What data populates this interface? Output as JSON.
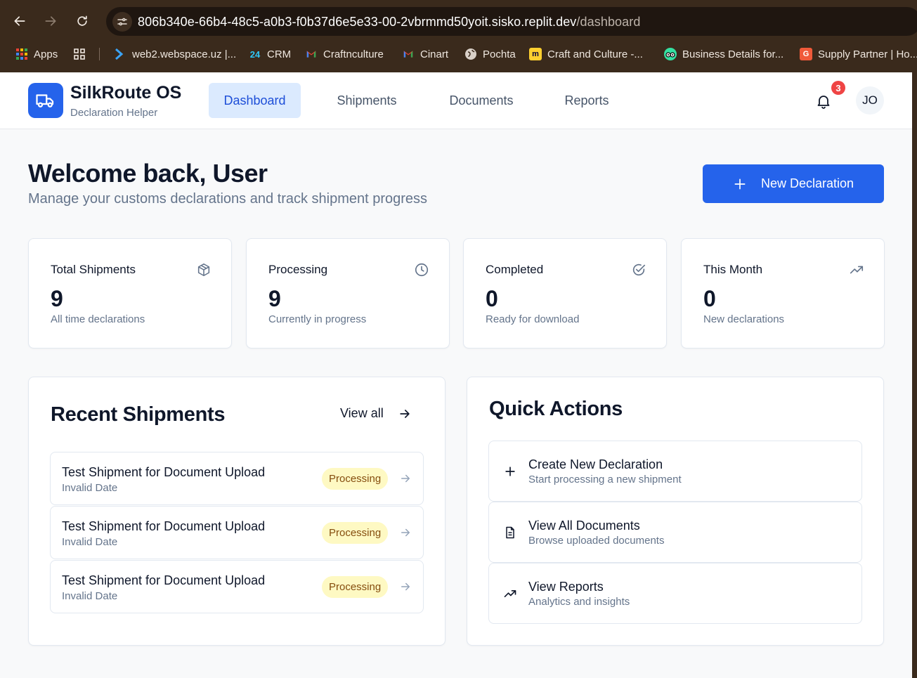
{
  "browser": {
    "url_host": "806b340e-66b4-48c5-a0b3-f0b37d6e5e33-00-2vbrmmd50yoit.sisko.replit.dev",
    "url_path": "/dashboard",
    "bookmarks": [
      {
        "label": "Apps",
        "icon": "apps-grid-icon"
      },
      {
        "label": "web2.webspace.uz |...",
        "icon": "webspace-icon"
      },
      {
        "label": "CRM",
        "icon": "crm-icon"
      },
      {
        "label": "Craftnculture",
        "icon": "gmail-icon"
      },
      {
        "label": "Cinart",
        "icon": "gmail-icon"
      },
      {
        "label": "Pochta",
        "icon": "globe-icon"
      },
      {
        "label": "Craft and Culture -...",
        "icon": "miro-icon"
      },
      {
        "label": "Business Details for...",
        "icon": "tripadvisor-icon"
      },
      {
        "label": "Supply Partner | Ho...",
        "icon": "g-icon"
      }
    ]
  },
  "header": {
    "brand_name": "SilkRoute OS",
    "brand_sub": "Declaration Helper",
    "nav": [
      "Dashboard",
      "Shipments",
      "Documents",
      "Reports"
    ],
    "active_nav": "Dashboard",
    "notifications_count": "3",
    "avatar_initials": "JO"
  },
  "welcome": {
    "title": "Welcome back, User",
    "subtitle": "Manage your customs declarations and track shipment progress",
    "new_declaration_label": "New Declaration"
  },
  "stats": [
    {
      "label": "Total Shipments",
      "value": "9",
      "desc": "All time declarations",
      "icon": "package-icon"
    },
    {
      "label": "Processing",
      "value": "9",
      "desc": "Currently in progress",
      "icon": "clock-icon"
    },
    {
      "label": "Completed",
      "value": "0",
      "desc": "Ready for download",
      "icon": "check-circle-icon"
    },
    {
      "label": "This Month",
      "value": "0",
      "desc": "New declarations",
      "icon": "trending-up-icon"
    }
  ],
  "recent": {
    "title": "Recent Shipments",
    "view_all": "View all",
    "items": [
      {
        "title": "Test Shipment for Document Upload",
        "date": "Invalid Date",
        "status": "Processing"
      },
      {
        "title": "Test Shipment for Document Upload",
        "date": "Invalid Date",
        "status": "Processing"
      },
      {
        "title": "Test Shipment for Document Upload",
        "date": "Invalid Date",
        "status": "Processing"
      }
    ]
  },
  "quick_actions": {
    "title": "Quick Actions",
    "items": [
      {
        "title": "Create New Declaration",
        "desc": "Start processing a new shipment",
        "icon": "plus-icon"
      },
      {
        "title": "View All Documents",
        "desc": "Browse uploaded documents",
        "icon": "document-icon"
      },
      {
        "title": "View Reports",
        "desc": "Analytics and insights",
        "icon": "trending-up-icon"
      }
    ]
  },
  "colors": {
    "primary": "#2563eb",
    "status_processing_bg": "#fef9c3",
    "status_processing_text": "#854d0e",
    "browser_chrome": "#3a2a1c"
  }
}
